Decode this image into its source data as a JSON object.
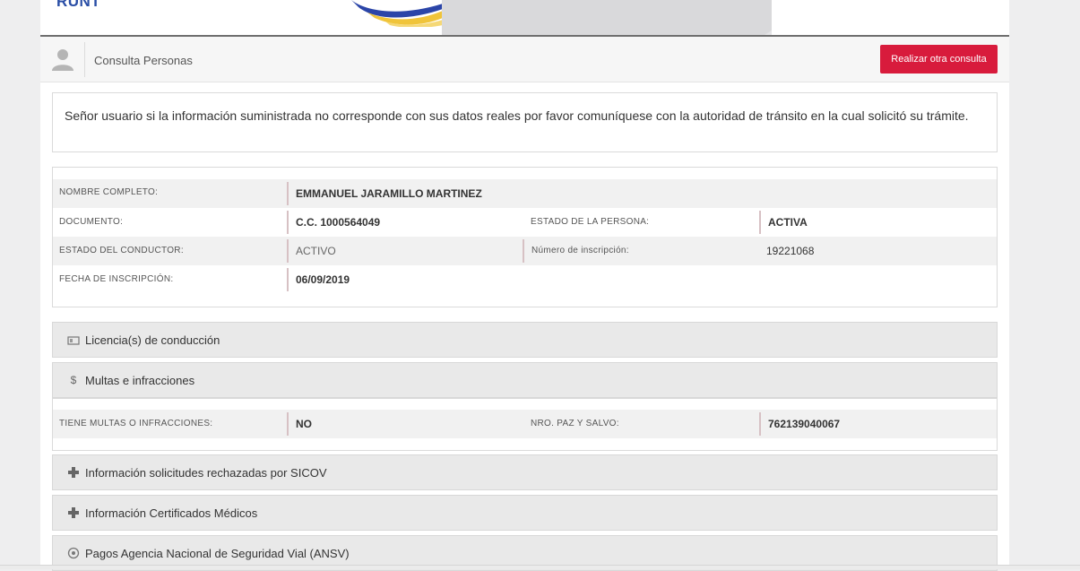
{
  "header": {
    "logo_text": "RUNT"
  },
  "titlebar": {
    "title": "Consulta Personas",
    "action_label": "Realizar otra consulta",
    "action_color": "#d81b3c"
  },
  "notice": "Señor usuario si la información suministrada no corresponde con sus datos reales por favor comuníquese con la autoridad de tránsito en la cual solicitó su trámite.",
  "person": {
    "nombre_label": "NOMBRE COMPLETO:",
    "nombre": "EMMANUEL JARAMILLO MARTINEZ",
    "documento_label": "DOCUMENTO:",
    "documento": "C.C. 1000564049",
    "estado_persona_label": "ESTADO DE LA PERSONA:",
    "estado_persona": "ACTIVA",
    "estado_conductor_label": "ESTADO DEL CONDUCTOR:",
    "estado_conductor": "ACTIVO",
    "numero_inscripcion_label": "Número de inscripción:",
    "numero_inscripcion": "19221068",
    "fecha_inscripcion_label": "FECHA DE INSCRIPCIÓN:",
    "fecha_inscripcion": "06/09/2019"
  },
  "sections": {
    "licencias": {
      "label": "Licencia(s) de conducción",
      "icon": "id-card-icon"
    },
    "multas": {
      "label": "Multas e infracciones",
      "icon": "dollar-icon"
    },
    "sicov": {
      "label": "Información solicitudes rechazadas por SICOV",
      "icon": "plus-cross-icon"
    },
    "medicos": {
      "label": "Información Certificados Médicos",
      "icon": "plus-cross-icon"
    },
    "ansv": {
      "label": "Pagos Agencia Nacional de Seguridad Vial (ANSV)",
      "icon": "payment-icon"
    }
  },
  "multas_data": {
    "tiene_label": "TIENE MULTAS O INFRACCIONES:",
    "tiene": "NO",
    "paz_salvo_label": "NRO. PAZ Y SALVO:",
    "paz_salvo": "762139040067"
  }
}
